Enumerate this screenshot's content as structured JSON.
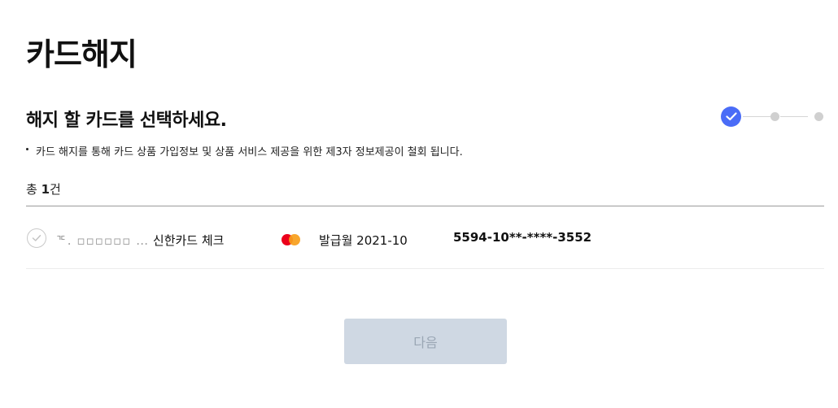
{
  "page": {
    "title": "카드해지"
  },
  "section": {
    "title": "해지 할 카드를 선택하세요.",
    "notice": "카드 해지를 통해 카드 상품 가입정보 및 상품 서비스 제공을 위한 제3자 정보제공이 철회 됩니다."
  },
  "stepper": {
    "current_step": 1,
    "total_steps": 3,
    "accent_color": "#4a6cf7",
    "inactive_color": "#d0d0d0"
  },
  "summary": {
    "prefix": "총",
    "count": "1",
    "suffix": "건"
  },
  "cards": [
    {
      "masked_name": "ᄀᄃ. ▫▫▫▫▫▫ …",
      "name": "신한카드 체크",
      "brand_icon": "mastercard-icon",
      "issue_date_label": "발급월 2021-10",
      "card_number": "5594-10**-****-3552",
      "selected": false
    }
  ],
  "actions": {
    "next_label": "다음",
    "next_enabled": false
  }
}
